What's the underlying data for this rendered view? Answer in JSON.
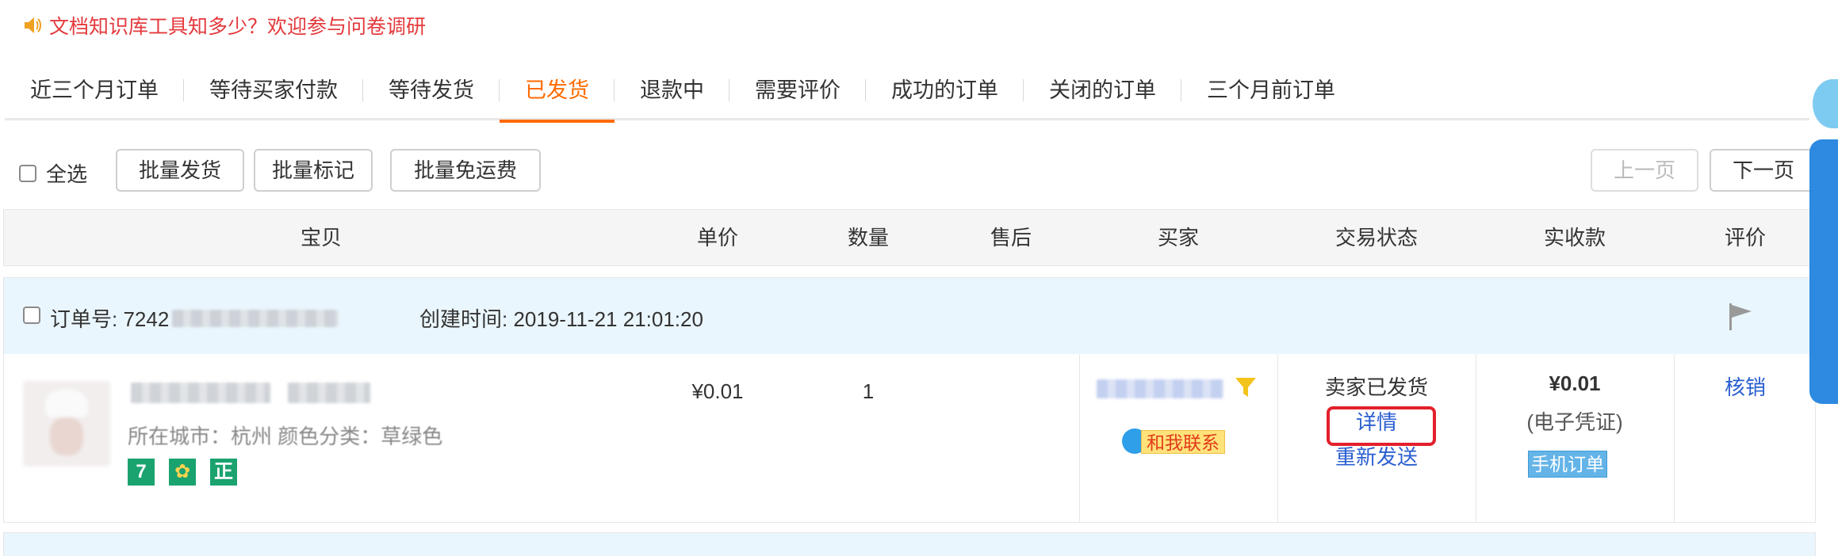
{
  "notice": {
    "icon": "speaker-icon",
    "text": "文档知识库工具知多少？欢迎参与问卷调研"
  },
  "tabs": [
    {
      "label": "近三个月订单"
    },
    {
      "label": "等待买家付款"
    },
    {
      "label": "等待发货"
    },
    {
      "label": "已发货",
      "active": true
    },
    {
      "label": "退款中"
    },
    {
      "label": "需要评价"
    },
    {
      "label": "成功的订单"
    },
    {
      "label": "关闭的订单"
    },
    {
      "label": "三个月前订单"
    }
  ],
  "toolbar": {
    "select_all": "全选",
    "batch_ship": "批量发货",
    "batch_mark": "批量标记",
    "batch_free_shipping": "批量免运费",
    "prev_page": "上一页",
    "next_page": "下一页"
  },
  "columns": {
    "item": "宝贝",
    "unit_price": "单价",
    "quantity": "数量",
    "after_sale": "售后",
    "buyer": "买家",
    "status": "交易状态",
    "paid": "实收款",
    "review": "评价"
  },
  "order": {
    "order_no_label": "订单号: 7242",
    "created_label": "创建时间: 2019-11-21 21:01:20",
    "sku_text": "所在城市：杭州  颜色分类：草绿色",
    "badges": [
      "7",
      "✿",
      "正"
    ],
    "unit_price": "¥0.01",
    "quantity": "1",
    "contact_label": "和我联系",
    "status_text": "卖家已发货",
    "detail_link": "详情",
    "resend_link": "重新发送",
    "paid_amount": "¥0.01",
    "paid_note": "(电子凭证)",
    "mobile_tag": "手机订单",
    "review_link": "核销"
  },
  "colors": {
    "accent": "#ff6a00",
    "notice_red": "#e4393c",
    "link_blue": "#2a5fd0",
    "highlight_box": "#e3202c"
  }
}
